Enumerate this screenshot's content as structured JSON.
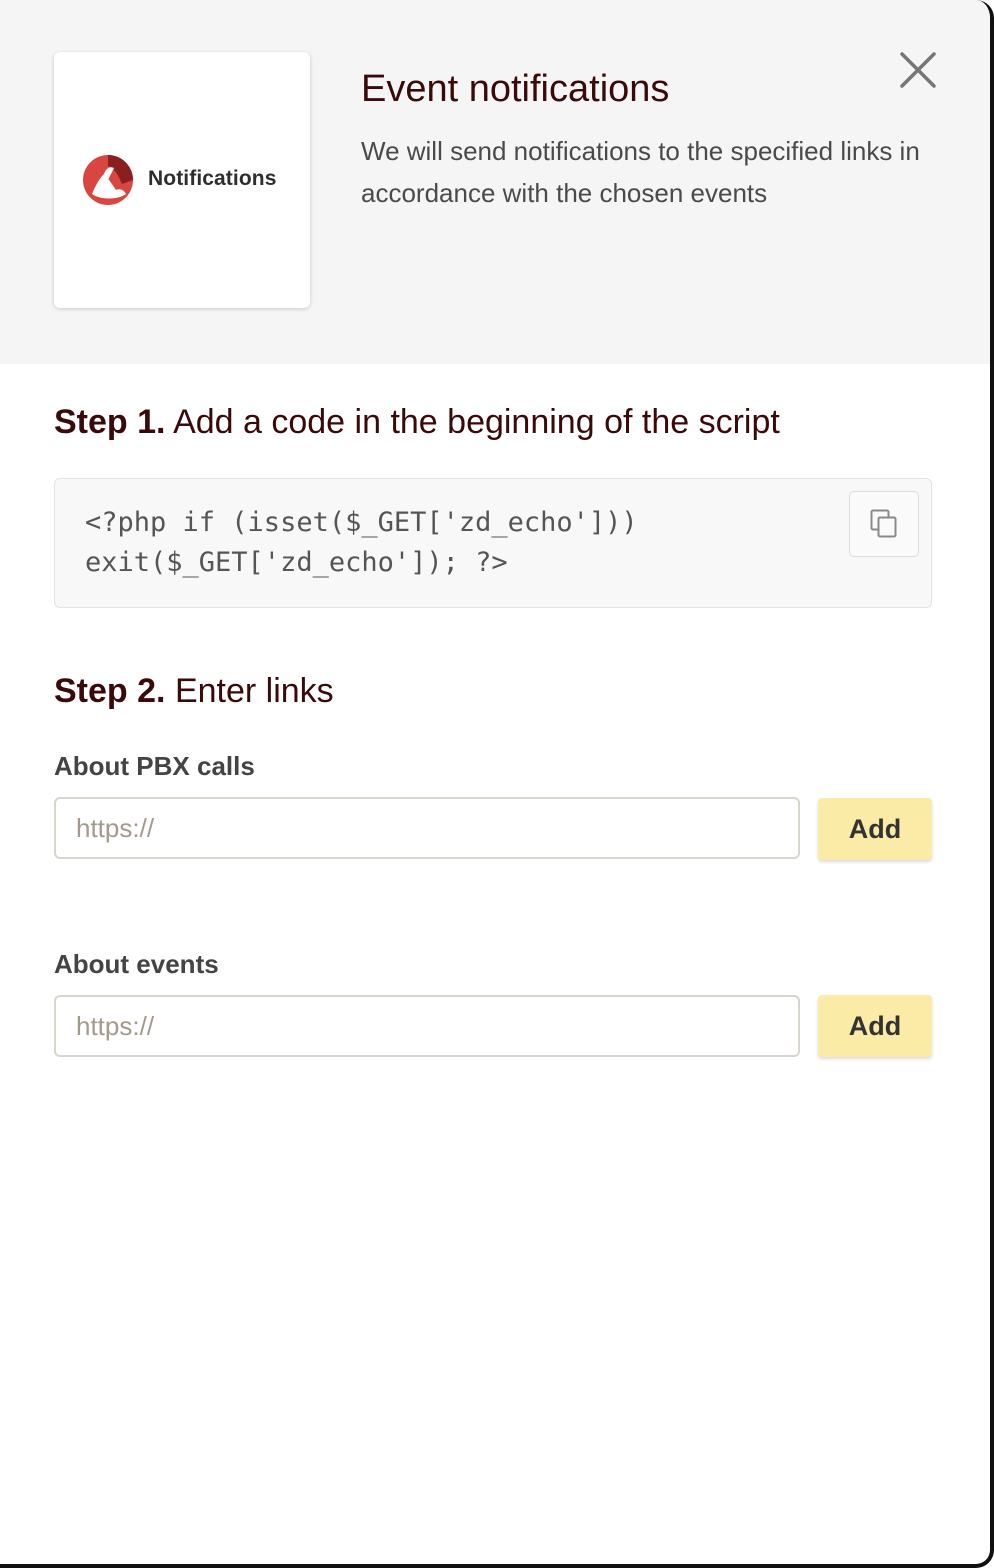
{
  "header": {
    "logo_text": "Notifications",
    "title": "Event notifications",
    "subtitle": "We will send notifications to the specified links in accordance with the chosen events"
  },
  "step1": {
    "number": "Step 1.",
    "text": "Add a code in the beginning of the script",
    "code": "<?php if (isset($_GET['zd_echo']))\nexit($_GET['zd_echo']); ?>"
  },
  "step2": {
    "number": "Step 2.",
    "text": "Enter links"
  },
  "fields": {
    "pbx": {
      "label": "About PBX calls",
      "placeholder": "https://",
      "value": "",
      "button": "Add"
    },
    "events": {
      "label": "About events",
      "placeholder": "https://",
      "value": "",
      "button": "Add"
    }
  },
  "colors": {
    "accent_dark": "#3a0a0a",
    "button_bg": "#faeba7",
    "logo_red": "#d9453f",
    "logo_dark": "#8a1f1f"
  },
  "icons": {
    "close": "close-icon",
    "copy": "copy-icon",
    "logo": "logo-icon"
  }
}
